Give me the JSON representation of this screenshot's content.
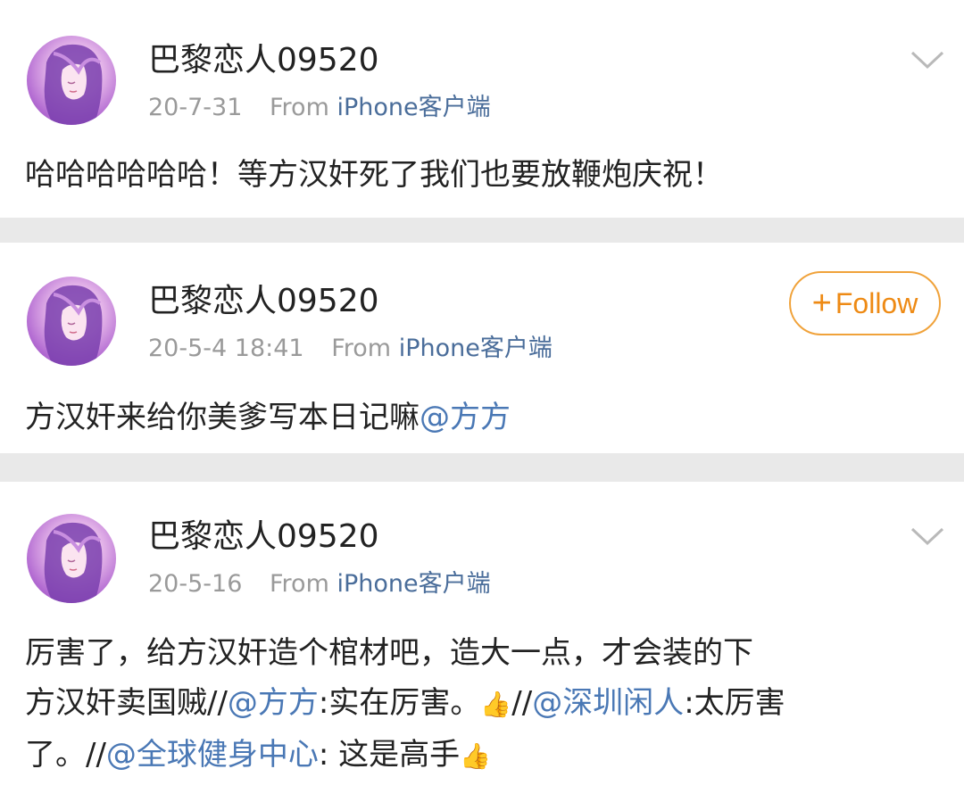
{
  "posts": [
    {
      "username": "巴黎恋人09520",
      "date": "20-7-31",
      "from_label": "From",
      "source": "iPhone客户端",
      "text": "哈哈哈哈哈哈！等方汉奸死了我们也要放鞭炮庆祝！"
    },
    {
      "username": "巴黎恋人09520",
      "date": "20-5-4 18:41",
      "from_label": "From",
      "source": "iPhone客户端",
      "follow_label": "Follow",
      "text_plain": "方汉奸来给你美爹写本日记嘛",
      "mention": "@方方"
    },
    {
      "username": "巴黎恋人09520",
      "date": "20-5-16",
      "from_label": "From",
      "source": "iPhone客户端",
      "line1": "厉害了，给方汉奸造个棺材吧，造大一点，才会装的下",
      "line2_a": "方汉奸卖国贼//",
      "mention1": "@方方",
      "line2_b": ":实在厉害。",
      "line2_c": "//",
      "mention2": "@深圳闲人",
      "line2_d": ":太厉害",
      "line3_a": "了。//",
      "mention3": "@全球健身中心",
      "line3_b": ": 这是高手"
    }
  ],
  "icons": {
    "chevron": "chevron-down-icon",
    "thumbs_up": "thumbs-up-emoji",
    "avatar": "user-avatar"
  },
  "colors": {
    "background": "#e9e9e9",
    "card": "#ffffff",
    "username": "#222222",
    "meta": "#9a9a9a",
    "source_link": "#4a6d9a",
    "mention": "#4a78b5",
    "follow_accent": "#ee8a14"
  }
}
